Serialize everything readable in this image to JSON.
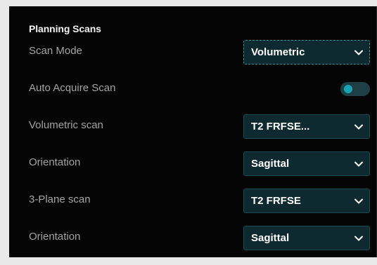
{
  "section": {
    "title": "Planning Scans"
  },
  "rows": [
    {
      "label": "Scan Mode",
      "value": "Volumetric"
    },
    {
      "label": "Auto Acquire Scan",
      "toggle_on": false
    },
    {
      "label": "Volumetric scan",
      "value": "T2 FRFSE..."
    },
    {
      "label": "Orientation",
      "value": "Sagittal"
    },
    {
      "label": "3-Plane scan",
      "value": "T2 FRFSE"
    },
    {
      "label": "Orientation",
      "value": "Sagittal"
    }
  ],
  "colors": {
    "panel_bg": "#050505",
    "dropdown_bg": "#0e2a30",
    "accent": "#1aa3b3",
    "label_text": "#a3a3a3"
  },
  "icons": {
    "dropdown": "chevron-down-icon"
  }
}
